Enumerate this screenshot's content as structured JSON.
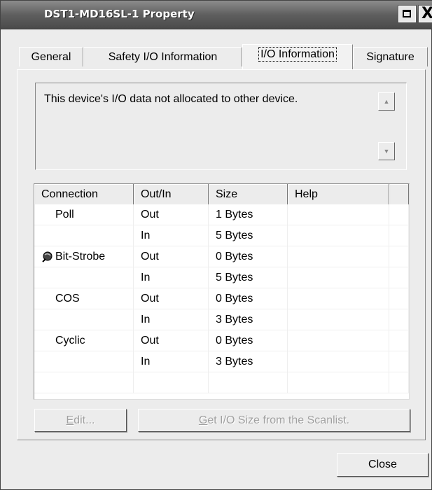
{
  "window": {
    "title": "DST1-MD16SL-1 Property",
    "close_glyph": "X"
  },
  "tabs": [
    {
      "label": "General"
    },
    {
      "label": "Safety I/O Information"
    },
    {
      "label": "I/O Information",
      "active": true
    },
    {
      "label": "Signature"
    }
  ],
  "message": "This device's I/O data not allocated to other device.",
  "grid": {
    "columns": [
      "Connection",
      "Out/In",
      "Size",
      "Help"
    ],
    "rows": [
      {
        "connection": "Poll",
        "direction": "Out",
        "size": "1 Bytes",
        "help": ""
      },
      {
        "connection": "",
        "direction": "In",
        "size": "5 Bytes",
        "help": ""
      },
      {
        "connection": "Bit-Strobe",
        "direction": "Out",
        "size": "0 Bytes",
        "help": "",
        "icon": "connection-status-icon"
      },
      {
        "connection": "",
        "direction": "In",
        "size": "5 Bytes",
        "help": ""
      },
      {
        "connection": "COS",
        "direction": "Out",
        "size": "0 Bytes",
        "help": ""
      },
      {
        "connection": "",
        "direction": "In",
        "size": "3 Bytes",
        "help": ""
      },
      {
        "connection": "Cyclic",
        "direction": "Out",
        "size": "0 Bytes",
        "help": ""
      },
      {
        "connection": "",
        "direction": "In",
        "size": "3 Bytes",
        "help": ""
      },
      {
        "connection": "",
        "direction": "",
        "size": "",
        "help": ""
      }
    ]
  },
  "buttons": {
    "edit_mnemonic": "E",
    "edit_rest": "dit...",
    "getsize_mnemonic": "G",
    "getsize_rest": "et I/O Size from the Scanlist.",
    "close": "Close"
  },
  "colors": {
    "titlebar": "#5f5f5f",
    "window_bg": "#ececec",
    "disabled_text": "#a0a0a0"
  }
}
